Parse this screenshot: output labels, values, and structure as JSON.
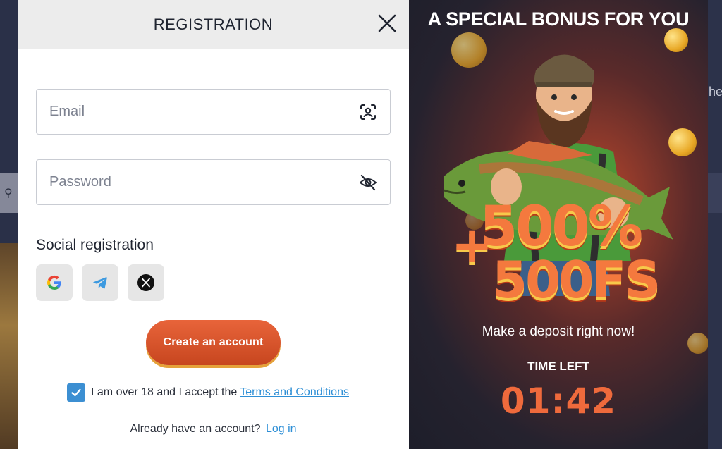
{
  "background": {
    "right_text": "he"
  },
  "registration": {
    "title": "REGISTRATION",
    "email_placeholder": "Email",
    "password_placeholder": "Password",
    "social_title": "Social registration",
    "social_icons": [
      "google-icon",
      "telegram-icon",
      "x-icon"
    ],
    "create_label": "Create an account",
    "terms_checked": true,
    "terms_text": "I am over 18 and I accept the",
    "terms_link": "Terms and Conditions",
    "login_text": "Already have an account?",
    "login_link": "Log in"
  },
  "bonus": {
    "title": "A SPECIAL BONUS FOR YOU",
    "plus": "+",
    "percent": "500%",
    "freespins": "500FS",
    "deposit_text": "Make a deposit right now!",
    "time_label": "TIME LEFT",
    "timer": "01:42"
  },
  "colors": {
    "accent_orange": "#e8643a",
    "link_blue": "#2e8fd6",
    "checkbox_blue": "#3c8fd2",
    "timer_orange": "#ef6a3c"
  }
}
